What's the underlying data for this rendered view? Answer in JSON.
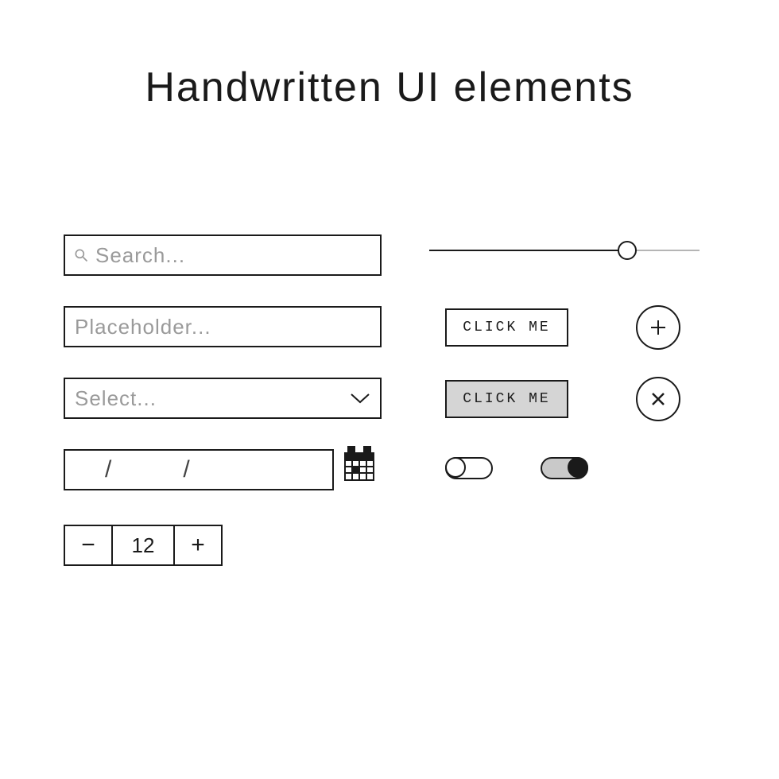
{
  "title": "Handwritten UI elements",
  "search": {
    "placeholder": "Search..."
  },
  "text_input": {
    "placeholder": "Placeholder..."
  },
  "select": {
    "placeholder": "Select..."
  },
  "date_input": {
    "value": "   /   /"
  },
  "stepper": {
    "minus": "−",
    "plus": "+",
    "value": "12"
  },
  "buttons": {
    "primary": "CLICK ME",
    "secondary": "CLICK ME"
  },
  "slider": {
    "min": 0,
    "max": 100,
    "value": 70
  },
  "toggles": {
    "off": false,
    "on": true
  },
  "icons": {
    "search": "search-icon",
    "chevron_down": "chevron-down-icon",
    "calendar": "calendar-icon",
    "plus": "plus-icon",
    "close": "close-icon"
  }
}
